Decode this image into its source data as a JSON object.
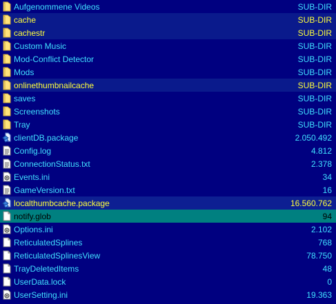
{
  "colors": {
    "panel_bg": "#000080",
    "text_normal": "#40e0ff",
    "text_selected": "#ffff3c",
    "cursor_bg": "#008080"
  },
  "file_list": {
    "rows": [
      {
        "name": "Aufgenommene Videos",
        "size": "SUB-DIR",
        "icon": "folder-icon",
        "selected": false,
        "cursor": false
      },
      {
        "name": "cache",
        "size": "SUB-DIR",
        "icon": "folder-icon",
        "selected": true,
        "cursor": false
      },
      {
        "name": "cachestr",
        "size": "SUB-DIR",
        "icon": "folder-icon",
        "selected": true,
        "cursor": false
      },
      {
        "name": "Custom Music",
        "size": "SUB-DIR",
        "icon": "folder-icon",
        "selected": false,
        "cursor": false
      },
      {
        "name": "Mod-Conflict Detector",
        "size": "SUB-DIR",
        "icon": "folder-icon",
        "selected": false,
        "cursor": false
      },
      {
        "name": "Mods",
        "size": "SUB-DIR",
        "icon": "folder-icon",
        "selected": false,
        "cursor": false
      },
      {
        "name": "onlinethumbnailcache",
        "size": "SUB-DIR",
        "icon": "folder-icon",
        "selected": true,
        "cursor": false
      },
      {
        "name": "saves",
        "size": "SUB-DIR",
        "icon": "folder-icon",
        "selected": false,
        "cursor": false
      },
      {
        "name": "Screenshots",
        "size": "SUB-DIR",
        "icon": "folder-icon",
        "selected": false,
        "cursor": false
      },
      {
        "name": "Tray",
        "size": "SUB-DIR",
        "icon": "folder-icon",
        "selected": false,
        "cursor": false
      },
      {
        "name": "clientDB.package",
        "size": "2.050.492",
        "icon": "package-icon",
        "selected": false,
        "cursor": false
      },
      {
        "name": "Config.log",
        "size": "4.812",
        "icon": "document-icon",
        "selected": false,
        "cursor": false
      },
      {
        "name": "ConnectionStatus.txt",
        "size": "2.378",
        "icon": "document-icon",
        "selected": false,
        "cursor": false
      },
      {
        "name": "Events.ini",
        "size": "34",
        "icon": "settings-file-icon",
        "selected": false,
        "cursor": false
      },
      {
        "name": "GameVersion.txt",
        "size": "16",
        "icon": "document-icon",
        "selected": false,
        "cursor": false
      },
      {
        "name": "localthumbcache.package",
        "size": "16.560.762",
        "icon": "package-icon",
        "selected": true,
        "cursor": false
      },
      {
        "name": "notify.glob",
        "size": "94",
        "icon": "blank-file-icon",
        "selected": false,
        "cursor": true
      },
      {
        "name": "Options.ini",
        "size": "2.102",
        "icon": "settings-file-icon",
        "selected": false,
        "cursor": false
      },
      {
        "name": "ReticulatedSplines",
        "size": "768",
        "icon": "blank-file-icon",
        "selected": false,
        "cursor": false
      },
      {
        "name": "ReticulatedSplinesView",
        "size": "78.750",
        "icon": "blank-file-icon",
        "selected": false,
        "cursor": false
      },
      {
        "name": "TrayDeletedItems",
        "size": "48",
        "icon": "blank-file-icon",
        "selected": false,
        "cursor": false
      },
      {
        "name": "UserData.lock",
        "size": "0",
        "icon": "blank-file-icon",
        "selected": false,
        "cursor": false
      },
      {
        "name": "UserSetting.ini",
        "size": "19.363",
        "icon": "settings-file-icon",
        "selected": false,
        "cursor": false
      }
    ]
  }
}
